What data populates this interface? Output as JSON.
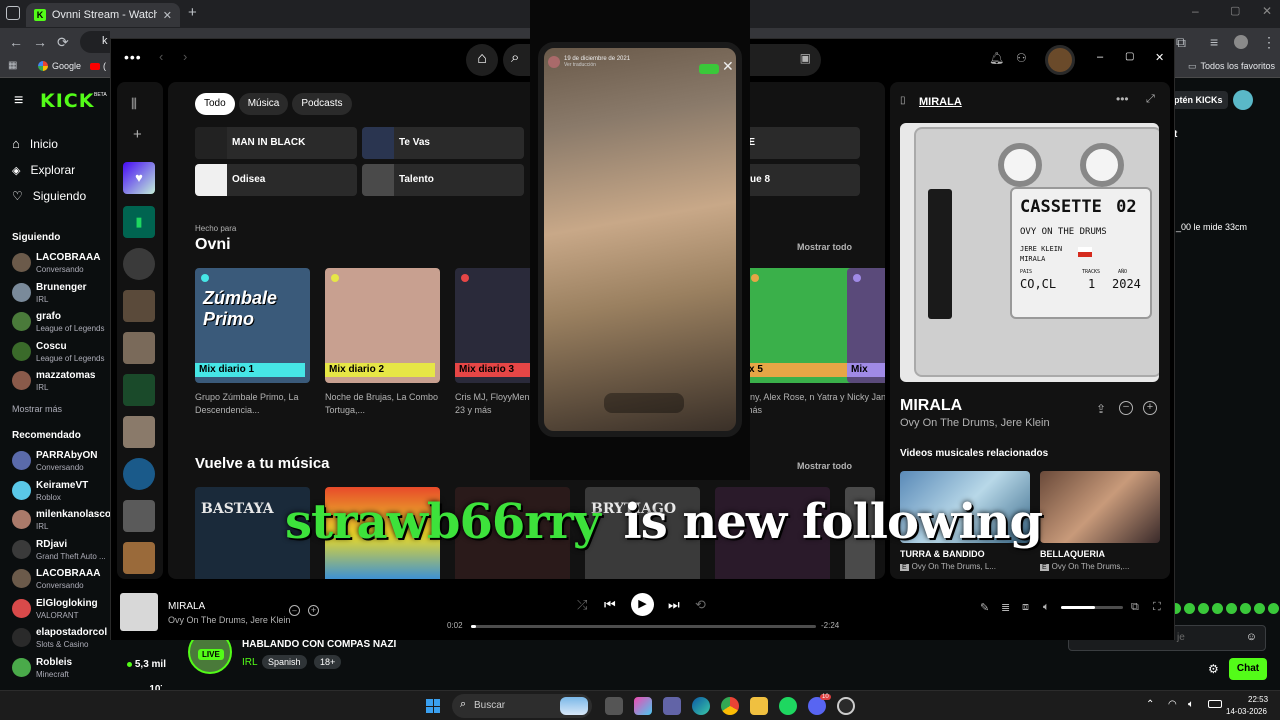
{
  "browser": {
    "tab_title": "Ovnni Stream - Watch Live on K",
    "addr_prefix": "k",
    "bookmarks": [
      {
        "label": "Google"
      },
      {
        "label": "(",
        "icon": "youtube-icon"
      }
    ],
    "bookmarks_right": "Todos los favoritos"
  },
  "kick": {
    "logo": "KICK",
    "beta": "BETA",
    "nav": [
      {
        "label": "Inicio",
        "icon": "home-icon"
      },
      {
        "label": "Explorar",
        "icon": "compass-icon"
      },
      {
        "label": "Siguiendo",
        "icon": "heart-icon"
      }
    ],
    "following_title": "Siguiendo",
    "following": [
      {
        "name": "LACOBRAAA",
        "game": "Conversando",
        "color": "#6b5a4a"
      },
      {
        "name": "Brunenger",
        "game": "IRL",
        "color": "#7a8a9a"
      },
      {
        "name": "grafo",
        "game": "League of Legends",
        "color": "#4a7a3a"
      },
      {
        "name": "Coscu",
        "game": "League of Legends",
        "color": "#3a6a2a"
      },
      {
        "name": "mazzatomas",
        "game": "IRL",
        "color": "#8a5a4a"
      }
    ],
    "show_more": "Mostrar más",
    "recommended_title": "Recomendado",
    "recommended": [
      {
        "name": "PARRAbyON",
        "game": "Conversando",
        "color": "#5a6aaa"
      },
      {
        "name": "KeirameVT",
        "game": "Roblox",
        "color": "#5ac8e8"
      },
      {
        "name": "milenkanolasco",
        "game": "IRL",
        "color": "#aa7a6a"
      },
      {
        "name": "RDjavi",
        "game": "Grand Theft Auto ...",
        "color": "#3a3a3a"
      },
      {
        "name": "LACOBRAAA",
        "game": "Conversando",
        "color": "#6b5a4a"
      },
      {
        "name": "ElGlogloking",
        "game": "VALORANT",
        "color": "#d84a4a"
      },
      {
        "name": "elapostadorcol",
        "game": "Slots & Casino",
        "color": "#2a2a2a"
      },
      {
        "name": "Robleis",
        "game": "Minecraft",
        "color": "#4aaa4a",
        "viewers": "5,3 mil"
      }
    ],
    "extra_partial_viewers": "107",
    "stream_title": "HABLANDO CON COMPAS NAZI",
    "stream_category": "IRL",
    "stream_tags": [
      "Spanish",
      "18+"
    ],
    "live_badge": "LIVE",
    "right_chip": "ptén KICKs",
    "chat_fragment_1": "t",
    "chat_fragment_2": "_00 le mide 33cm",
    "chat_input_placeholder": "je",
    "chat_button": "Chat"
  },
  "spotify": {
    "filters": [
      "Todo",
      "Música",
      "Podcasts"
    ],
    "quick": [
      {
        "label": "MAN IN BLACK",
        "color": "#222"
      },
      {
        "label": "Te Vas",
        "color": "#2a3550"
      },
      {
        "label": "RTE",
        "color": "#333"
      },
      {
        "label": "Odisea",
        "color": "#f0f0f0"
      },
      {
        "label": "Talento",
        "color": "#4a4a4a"
      },
      {
        "label": "loque 8",
        "color": "#333"
      }
    ],
    "made_for_label": "Hecho para",
    "made_for_name": "Ovni",
    "show_all": "Mostrar todo",
    "mixes": [
      {
        "band": "Mix diario 1",
        "band_color": "#46e6e6",
        "desc": "Grupo Zúmbale Primo, La Descendencia...",
        "bg": "#3a5a7a",
        "cover_text": "Zúmbale Primo"
      },
      {
        "band": "Mix diario 2",
        "band_color": "#e6e646",
        "desc": "Noche de Brujas, La Combo Tortuga,...",
        "bg": "#c8a090"
      },
      {
        "band": "Mix diario 3",
        "band_color": "#e64646",
        "desc": "Cris MJ, FloyyMen Jordan 23 y más",
        "bg": "#2a2a3a"
      },
      {
        "band": "x 5",
        "band_color": "#e6a646",
        "desc": "nny, Alex Rose, n Yatra y más",
        "bg": "#3ab04a"
      },
      {
        "band": "Mix",
        "band_color": "#a08ae6",
        "desc": "Nicky Jan",
        "bg": "#5a4a7a"
      }
    ],
    "back_title": "Vuelve a tu música",
    "back_show_all": "Mostrar todo",
    "back_cover_text": [
      "BASTAYA",
      "",
      "",
      "BRYTIAGO",
      ""
    ],
    "now_playing_panel": {
      "header": "MIRALA",
      "title": "MIRALA",
      "artists": "Ovy On The Drums, Jere Klein",
      "cassette_title": "CASSETTE",
      "cassette_num": "02",
      "cassette_artist": "OVY ON THE DRUMS",
      "cassette_sub1": "JERE KLEIN",
      "cassette_sub2": "MIRALA",
      "cassette_pais_label": "PAIS",
      "cassette_pais": "CO,CL",
      "cassette_tracks_label": "TRACKS",
      "cassette_tracks": "1",
      "cassette_year_label": "AÑO",
      "cassette_year": "2024",
      "related_title": "Videos musicales relacionados",
      "related": [
        {
          "title": "TURRA & BANDIDO",
          "sub": "Ovy On The Drums, L..."
        },
        {
          "title": "BELLAQUERIA",
          "sub": "Ovy On The Drums,..."
        }
      ]
    },
    "player": {
      "track": "MIRALA",
      "artists": "Ovy On The Drums, Jere Klein",
      "elapsed": "0:02",
      "remaining": "-2:24",
      "progress": 0.014,
      "volume": 0.55
    }
  },
  "video_overlay": {
    "phone_date": "19 de diciembre de 2021",
    "phone_sub": "Ver traducción"
  },
  "follow_alert": {
    "username": "strawb66rry",
    "message": "is new following"
  },
  "taskbar": {
    "search_placeholder": "Buscar",
    "time": "22:53",
    "date": "14-03-2026",
    "badge_count": "10"
  }
}
